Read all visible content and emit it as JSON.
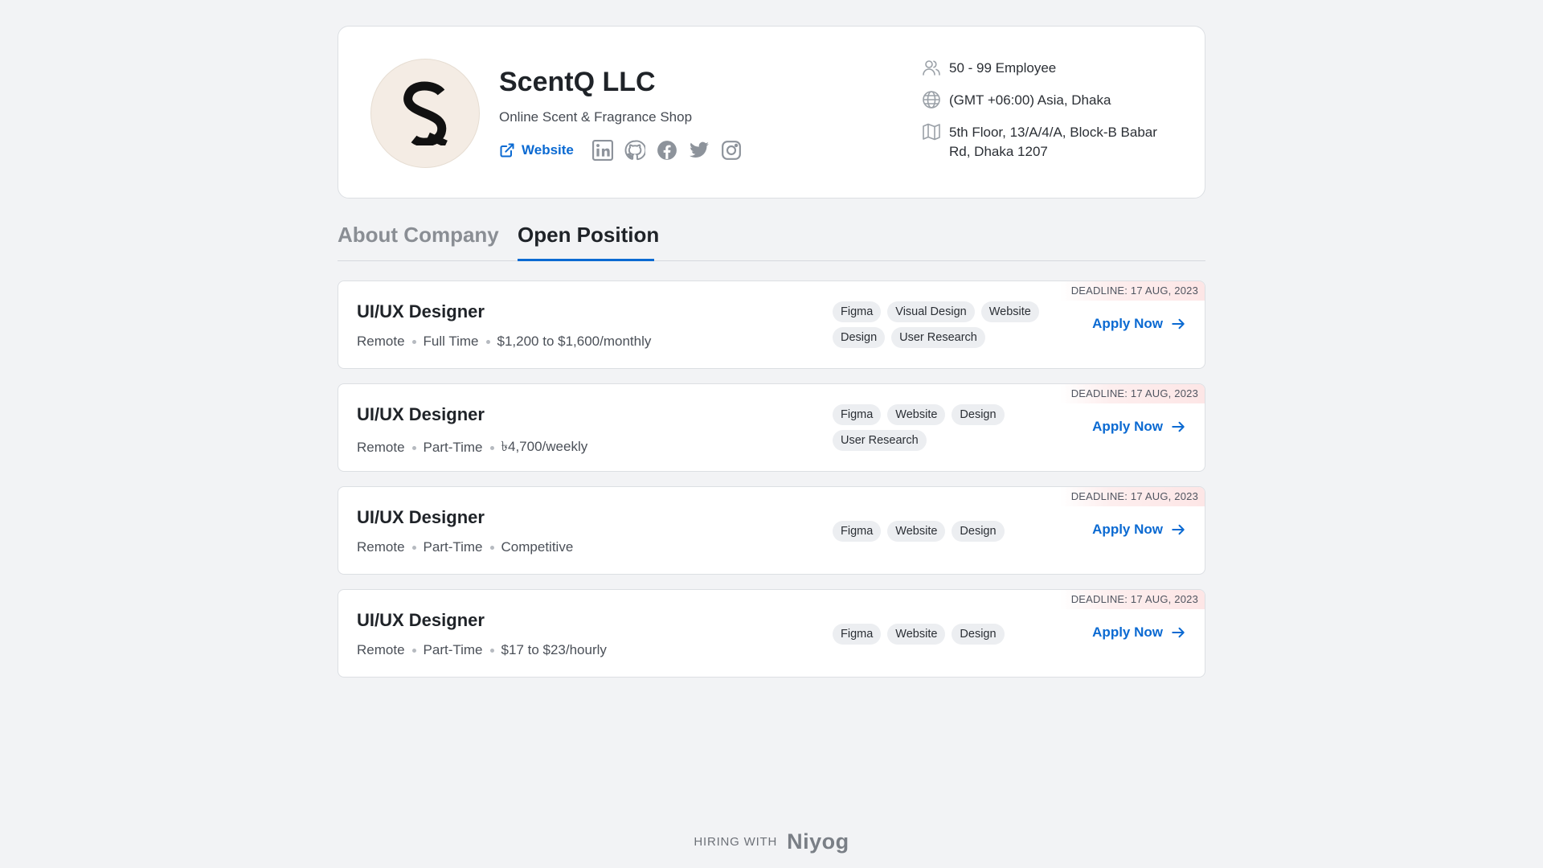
{
  "company": {
    "name": "ScentQ LLC",
    "tagline": "Online Scent & Fragrance Shop",
    "website_label": "Website",
    "employees": "50 - 99 Employee",
    "timezone": "(GMT +06:00) Asia, Dhaka",
    "address": "5th Floor, 13/A/4/A, Block-B Babar Rd, Dhaka 1207",
    "icons": [
      "linkedin-icon",
      "github-icon",
      "facebook-icon",
      "twitter-icon",
      "instagram-icon"
    ]
  },
  "tabs": {
    "about": "About Company",
    "open": "Open Position",
    "active": "open"
  },
  "jobs": [
    {
      "deadline": "DEADLINE: 17 AUG, 2023",
      "title": "UI/UX Designer",
      "location": "Remote",
      "type": "Full Time",
      "salary": "$1,200 to $1,600/monthly",
      "tags": [
        "Figma",
        "Visual Design",
        "Website",
        "Design",
        "User Research"
      ],
      "apply": "Apply Now"
    },
    {
      "deadline": "DEADLINE: 17 AUG, 2023",
      "title": "UI/UX Designer",
      "location": "Remote",
      "type": "Part-Time",
      "salary": "৳4,700/weekly",
      "tags": [
        "Figma",
        "Website",
        "Design",
        "User Research"
      ],
      "apply": "Apply Now"
    },
    {
      "deadline": "DEADLINE: 17 AUG, 2023",
      "title": "UI/UX Designer",
      "location": "Remote",
      "type": "Part-Time",
      "salary": "Competitive",
      "tags": [
        "Figma",
        "Website",
        "Design"
      ],
      "apply": "Apply Now"
    },
    {
      "deadline": "DEADLINE: 17 AUG, 2023",
      "title": "UI/UX Designer",
      "location": "Remote",
      "type": "Part-Time",
      "salary": "$17 to $23/hourly",
      "tags": [
        "Figma",
        "Website",
        "Design"
      ],
      "apply": "Apply Now"
    }
  ],
  "footer": {
    "hiring_with": "HIRING WITH",
    "brand": "Niyog"
  },
  "colors": {
    "accent": "#0b6ad2",
    "background": "#f2f3f5",
    "deadline_bg": "#fde6e6"
  }
}
